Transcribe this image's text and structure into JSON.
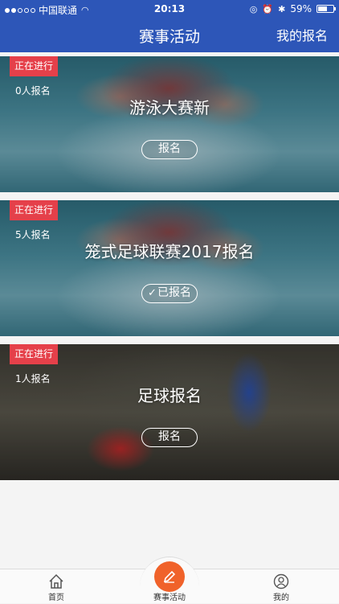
{
  "status_bar": {
    "carrier": "中国联通",
    "time": "20:13",
    "battery": "59%",
    "battery_level": 0.59
  },
  "nav": {
    "title": "赛事活动",
    "right_action": "我的报名"
  },
  "events": [
    {
      "status": "正在进行",
      "count": "0人报名",
      "title": "游泳大赛新",
      "button": "报名",
      "registered": false
    },
    {
      "status": "正在进行",
      "count": "5人报名",
      "title": "笼式足球联赛2017报名",
      "button": "已报名",
      "registered": true
    },
    {
      "status": "正在进行",
      "count": "1人报名",
      "title": "足球报名",
      "button": "报名",
      "registered": false
    }
  ],
  "tabs": {
    "home": "首页",
    "events": "赛事活动",
    "mine": "我的"
  },
  "colors": {
    "primary": "#2d56b8",
    "tag_red": "#e5404a",
    "center_button": "#f0622a"
  }
}
